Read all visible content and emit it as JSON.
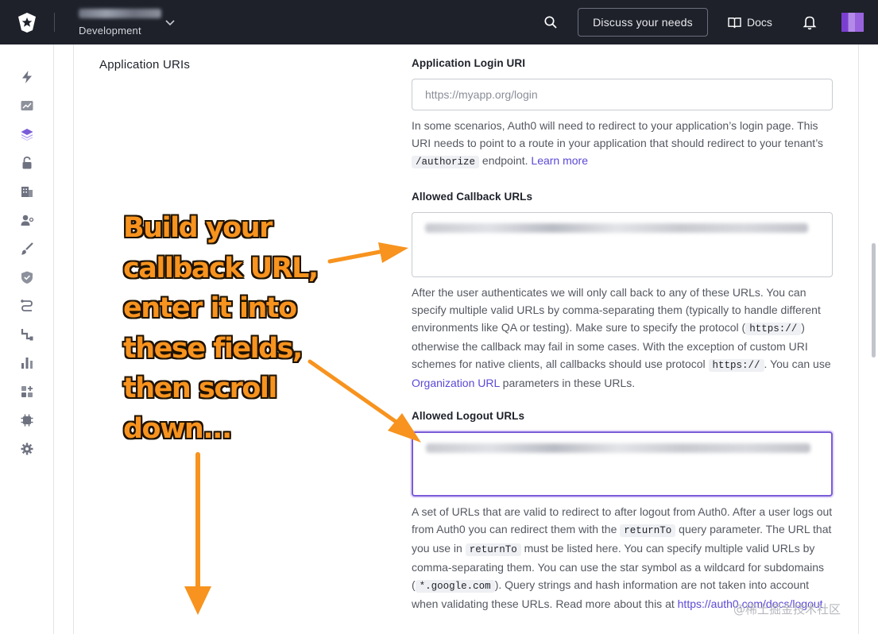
{
  "topbar": {
    "tenant_env": "Development",
    "discuss_label": "Discuss your needs",
    "docs_label": "Docs"
  },
  "sidebar": {
    "items": [
      "activity",
      "analytics",
      "applications",
      "authentication",
      "organizations",
      "user-management",
      "branding",
      "security",
      "actions",
      "pipelines",
      "monitoring",
      "marketplace",
      "extensions",
      "settings"
    ]
  },
  "section": {
    "title": "Application URIs"
  },
  "login_uri": {
    "label": "Application Login URI",
    "placeholder": "https://myapp.org/login",
    "help_before": "In some scenarios, Auth0 will need to redirect to your application’s login page. This URI needs to point to a route in your application that should redirect to your tenant’s",
    "help_code": "/authorize",
    "help_after": "endpoint.",
    "help_link": "Learn more"
  },
  "callback_urls": {
    "label": "Allowed Callback URLs",
    "help_1": "After the user authenticates we will only call back to any of these URLs. You can specify multiple valid URLs by comma-separating them (typically to handle different environments like QA or testing). Make sure to specify the protocol (",
    "help_code_1": "https://",
    "help_2": ") otherwise the callback may fail in some cases. With the exception of custom URI schemes for native clients, all callbacks should use protocol",
    "help_code_2": "https://",
    "help_3": ". You can use",
    "help_link": "Organization URL",
    "help_4": "parameters in these URLs."
  },
  "logout_urls": {
    "label": "Allowed Logout URLs",
    "help_1": "A set of URLs that are valid to redirect to after logout from Auth0. After a user logs out from Auth0 you can redirect them with the",
    "help_code_1": "returnTo",
    "help_2": "query parameter. The URL that you use in",
    "help_code_2": "returnTo",
    "help_3": "must be listed here. You can specify multiple valid URLs by comma-separating them. You can use the star symbol as a wildcard for subdomains (",
    "help_code_3": "*.google.com",
    "help_4": "). Query strings and hash information are not taken into account when validating these URLs. Read more about this at",
    "help_link": "https://auth0.com/docs/logout"
  },
  "annotation": {
    "lines": [
      "Build your",
      "callback URL,",
      "enter it into",
      "these fields,",
      "then scroll",
      "down..."
    ],
    "color": "#f7931e"
  },
  "watermark": "@稀土掘金技术社区",
  "colors": {
    "topbar": "#1e212a",
    "link": "#5b49d6",
    "focus": "#7a5cd8",
    "arrow": "#f7931e"
  }
}
